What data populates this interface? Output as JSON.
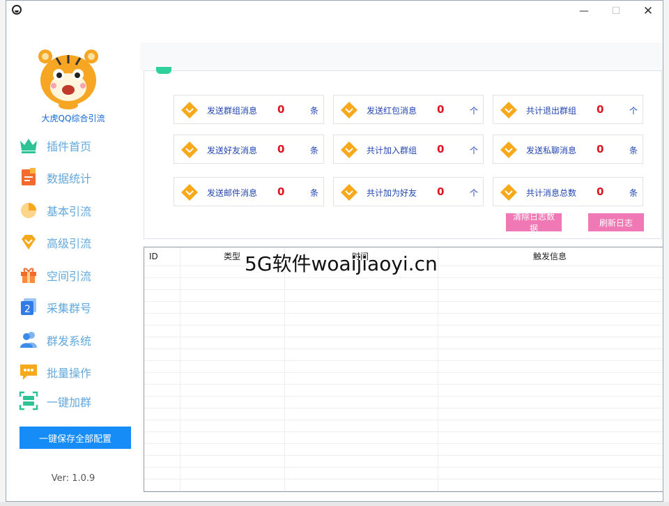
{
  "window": {
    "minimize_glyph": "—",
    "maximize_glyph": "☐",
    "close_glyph": "✕"
  },
  "sidebar": {
    "app_name": "大虎QQ综合引流",
    "items": [
      {
        "label": "插件首页",
        "icon": "crown-icon",
        "color": "#2ec394"
      },
      {
        "label": "数据统计",
        "icon": "document-icon",
        "color": "#f26b2c"
      },
      {
        "label": "基本引流",
        "icon": "pie-chart-icon",
        "color": "#f7a81b"
      },
      {
        "label": "高级引流",
        "icon": "diamond-icon",
        "color": "#f7a81b"
      },
      {
        "label": "空间引流",
        "icon": "gift-icon",
        "color": "#f26b2c"
      },
      {
        "label": "采集群号",
        "icon": "number-badge-icon",
        "color": "#2f7be8"
      },
      {
        "label": "群发系统",
        "icon": "users-icon",
        "color": "#3b8be9"
      },
      {
        "label": "批量操作",
        "icon": "chat-icon",
        "color": "#f7a81b"
      },
      {
        "label": "一键加群",
        "icon": "scan-icon",
        "color": "#2ec394"
      }
    ],
    "save_button": "一键保存全部配置",
    "version": "Ver: 1.0.9",
    "save_button_color": "#168cf7"
  },
  "stats": [
    {
      "label": "发送群组消息",
      "value": "0",
      "unit": "条"
    },
    {
      "label": "发送红包消息",
      "value": "0",
      "unit": "个"
    },
    {
      "label": "共计退出群组",
      "value": "0",
      "unit": "个"
    },
    {
      "label": "发送好友消息",
      "value": "0",
      "unit": "条"
    },
    {
      "label": "共计加入群组",
      "value": "0",
      "unit": "个"
    },
    {
      "label": "发送私聊消息",
      "value": "0",
      "unit": "条"
    },
    {
      "label": "发送邮件消息",
      "value": "0",
      "unit": "条"
    },
    {
      "label": "共计加为好友",
      "value": "0",
      "unit": "个"
    },
    {
      "label": "共计消息总数",
      "value": "0",
      "unit": "条"
    }
  ],
  "actions": {
    "clear_log": "清除日志数据",
    "refresh_log": "刷新日志",
    "button_color": "#f078b4"
  },
  "table": {
    "columns": [
      "ID",
      "类型",
      "时间",
      "触发信息"
    ],
    "rows": []
  },
  "watermark": "5G软件woaijiaoyi.cn",
  "colors": {
    "stat_value": "#e0141e",
    "stat_label": "#2246b0",
    "nav_label": "#62a8dd",
    "accent_green": "#2ed19a"
  }
}
